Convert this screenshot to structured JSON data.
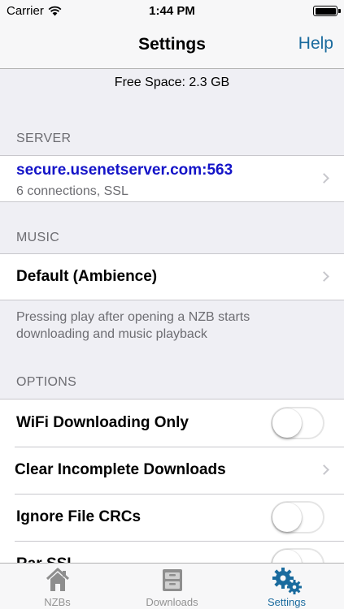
{
  "status_bar": {
    "carrier": "Carrier",
    "time": "1:44 PM"
  },
  "nav": {
    "title": "Settings",
    "help": "Help"
  },
  "free_space": "Free Space: 2.3 GB",
  "server": {
    "header": "SERVER",
    "host": "secure.usenetserver.com:563",
    "detail": "6 connections, SSL",
    "host_color": "#1414c8"
  },
  "music": {
    "header": "MUSIC",
    "selection": "Default (Ambience)",
    "footer": "Pressing play after opening a NZB starts downloading and music playback"
  },
  "options": {
    "header": "OPTIONS",
    "items": [
      {
        "label": "WiFi Downloading Only",
        "control": "toggle",
        "on": false
      },
      {
        "label": "Clear Incomplete Downloads",
        "control": "chevron"
      },
      {
        "label": "Ignore File CRCs",
        "control": "toggle",
        "on": false
      },
      {
        "label": "Rar SSL",
        "control": "toggle",
        "on": false
      }
    ]
  },
  "tabs": [
    {
      "label": "NZBs",
      "icon": "house-icon",
      "active": false
    },
    {
      "label": "Downloads",
      "icon": "archive-box-icon",
      "active": false
    },
    {
      "label": "Settings",
      "icon": "gears-icon",
      "active": true
    }
  ],
  "accent_color": "#1a6b9e"
}
